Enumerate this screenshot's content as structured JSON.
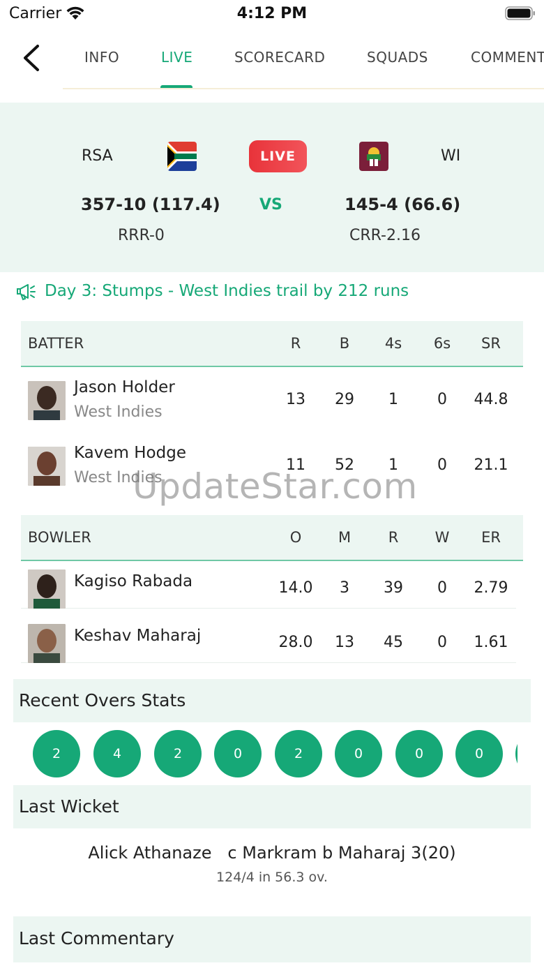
{
  "status_bar": {
    "carrier": "Carrier",
    "time": "4:12 PM"
  },
  "tabs": [
    "INFO",
    "LIVE",
    "SCORECARD",
    "SQUADS",
    "COMMENT"
  ],
  "active_tab": "LIVE",
  "match": {
    "team1": {
      "code": "RSA",
      "score": "357-10 (117.4)",
      "rate": "RRR-0"
    },
    "team2": {
      "code": "WI",
      "score": "145-4 (66.6)",
      "rate": "CRR-2.16"
    },
    "live_label": "LIVE",
    "vs_label": "VS"
  },
  "status_message": "Day 3: Stumps - West Indies trail by 212 runs",
  "batters": {
    "headers": [
      "BATTER",
      "R",
      "B",
      "4s",
      "6s",
      "SR"
    ],
    "rows": [
      {
        "name": "Jason Holder",
        "team": "West Indies",
        "r": "13",
        "b": "29",
        "fours": "1",
        "sixes": "0",
        "sr": "44.8"
      },
      {
        "name": "Kavem Hodge",
        "team": "West Indies",
        "r": "11",
        "b": "52",
        "fours": "1",
        "sixes": "0",
        "sr": "21.1"
      }
    ]
  },
  "bowlers": {
    "headers": [
      "BOWLER",
      "O",
      "M",
      "R",
      "W",
      "ER"
    ],
    "rows": [
      {
        "name": "Kagiso Rabada",
        "o": "14.0",
        "m": "3",
        "r": "39",
        "w": "0",
        "er": "2.79"
      },
      {
        "name": "Keshav Maharaj",
        "o": "28.0",
        "m": "13",
        "r": "45",
        "w": "0",
        "er": "1.61"
      }
    ]
  },
  "recent_overs": {
    "title": "Recent Overs Stats",
    "balls": [
      "2",
      "4",
      "2",
      "0",
      "2",
      "0",
      "0",
      "0"
    ]
  },
  "last_wicket": {
    "title": "Last Wicket",
    "batter": "Alick Athanaze",
    "detail": "c Markram b Maharaj 3(20)",
    "sub": "124/4 in 56.3 ov."
  },
  "last_commentary": {
    "title": "Last Commentary"
  },
  "watermark": "UpdateStar.com",
  "colors": {
    "accent": "#16a877",
    "live": "#e8333a",
    "panel": "#ecf6f2"
  }
}
